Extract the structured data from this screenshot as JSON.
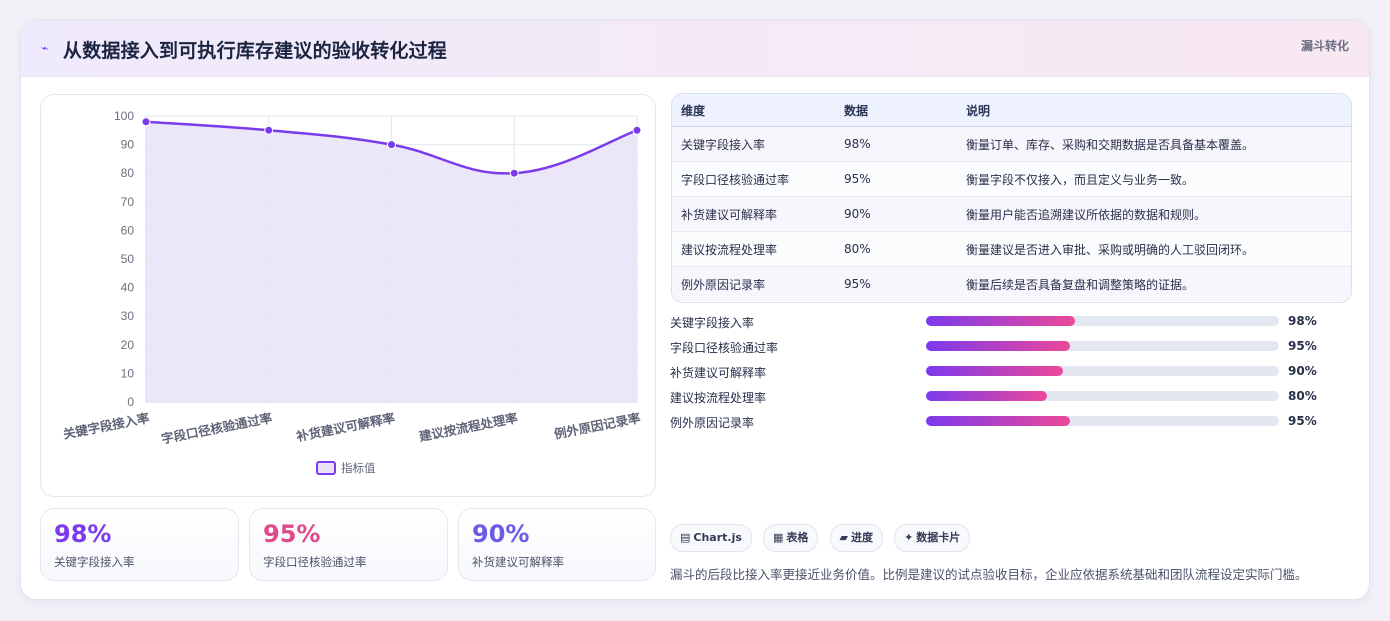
{
  "header": {
    "icon": "pulse-icon",
    "icon_glyph": "⌁",
    "title": "从数据接入到可执行库存建议的验收转化过程",
    "tag": "漏斗转化"
  },
  "chart_data": {
    "type": "line",
    "categories": [
      "关键字段接入率",
      "字段口径核验通过率",
      "补货建议可解释率",
      "建议按流程处理率",
      "例外原因记录率"
    ],
    "series": [
      {
        "name": "指标值",
        "values": [
          98,
          95,
          90,
          80,
          95
        ]
      }
    ],
    "ylim": [
      0,
      100
    ],
    "yticks": [
      0,
      10,
      20,
      30,
      40,
      50,
      60,
      70,
      80,
      90,
      100
    ],
    "fill": true,
    "legend": "bottom",
    "grid": true,
    "colors": {
      "line": "#7c3aed",
      "fill": "#e9e2f8"
    }
  },
  "kpis": [
    {
      "value": "98%",
      "label": "关键字段接入率",
      "color": "#7c3aed"
    },
    {
      "value": "95%",
      "label": "字段口径核验通过率",
      "color": "#e04a8c"
    },
    {
      "value": "90%",
      "label": "补货建议可解释率",
      "color": "#6b5be6"
    }
  ],
  "table": {
    "headers": [
      "维度",
      "数据",
      "说明"
    ],
    "rows": [
      [
        "关键字段接入率",
        "98%",
        "衡量订单、库存、采购和交期数据是否具备基本覆盖。"
      ],
      [
        "字段口径核验通过率",
        "95%",
        "衡量字段不仅接入，而且定义与业务一致。"
      ],
      [
        "补货建议可解释率",
        "90%",
        "衡量用户能否追溯建议所依据的数据和规则。"
      ],
      [
        "建议按流程处理率",
        "80%",
        "衡量建议是否进入审批、采购或明确的人工驳回闭环。"
      ],
      [
        "例外原因记录率",
        "95%",
        "衡量后续是否具备复盘和调整策略的证据。"
      ]
    ]
  },
  "progress": [
    {
      "label": "关键字段接入率",
      "value": "98%",
      "fraction": 0.98
    },
    {
      "label": "字段口径核验通过率",
      "value": "95%",
      "fraction": 0.95
    },
    {
      "label": "补货建议可解释率",
      "value": "90%",
      "fraction": 0.9
    },
    {
      "label": "建议按流程处理率",
      "value": "80%",
      "fraction": 0.8
    },
    {
      "label": "例外原因记录率",
      "value": "95%",
      "fraction": 0.95
    }
  ],
  "pills": [
    {
      "icon": "chart-icon",
      "glyph": "▤",
      "label": "Chart.js"
    },
    {
      "icon": "table-icon",
      "glyph": "▦",
      "label": "表格"
    },
    {
      "icon": "progress-icon",
      "glyph": "▰",
      "label": "进度"
    },
    {
      "icon": "sparkle-icon",
      "glyph": "✦",
      "label": "数据卡片"
    }
  ],
  "footer": "漏斗的后段比接入率更接近业务价值。比例是建议的试点验收目标，企业应依据系统基础和团队流程设定实际门槛。"
}
